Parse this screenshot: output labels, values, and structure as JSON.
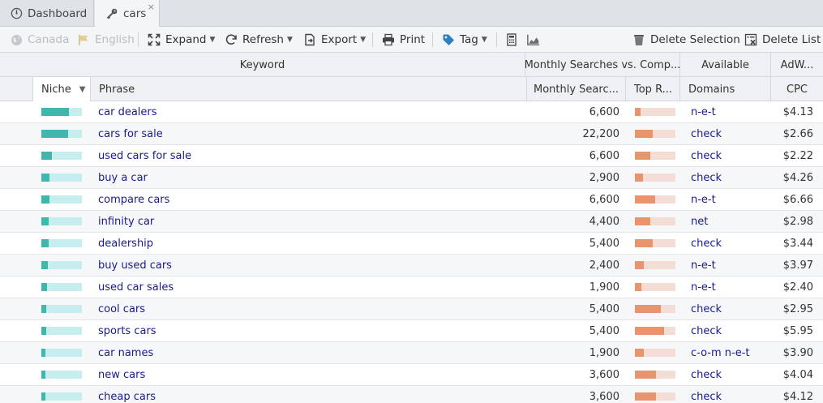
{
  "tabs": [
    {
      "label": "Dashboard"
    },
    {
      "label": "cars",
      "close": "×"
    }
  ],
  "toolbar": {
    "canada": "Canada",
    "english": "English",
    "expand": "Expand",
    "refresh": "Refresh",
    "export": "Export",
    "print": "Print",
    "tag": "Tag",
    "delete_selection": "Delete Selection",
    "delete_list": "Delete List"
  },
  "header_groups": {
    "keyword": "Keyword",
    "monthly": "Monthly Searches vs. Comp...",
    "available": "Available",
    "adwords": "AdW..."
  },
  "columns": {
    "niche": "Niche",
    "phrase": "Phrase",
    "monthly_searches": "Monthly Searc...",
    "top_rank": "Top R...",
    "domains": "Domains",
    "cpc": "CPC"
  },
  "rows": [
    {
      "niche": 0.68,
      "phrase": "car dealers",
      "searches": "6,600",
      "top": 0.14,
      "domains": "n-e-t",
      "cpc": "$4.13"
    },
    {
      "niche": 0.66,
      "phrase": "cars for sale",
      "searches": "22,200",
      "top": 0.44,
      "domains": "check",
      "cpc": "$2.66"
    },
    {
      "niche": 0.26,
      "phrase": "used cars for sale",
      "searches": "6,600",
      "top": 0.38,
      "domains": "check",
      "cpc": "$2.22"
    },
    {
      "niche": 0.2,
      "phrase": "buy a car",
      "searches": "2,900",
      "top": 0.2,
      "domains": "check",
      "cpc": "$4.26"
    },
    {
      "niche": 0.2,
      "phrase": "compare cars",
      "searches": "6,600",
      "top": 0.5,
      "domains": "n-e-t",
      "cpc": "$6.66"
    },
    {
      "niche": 0.18,
      "phrase": "infinity car",
      "searches": "4,400",
      "top": 0.38,
      "domains": "net",
      "cpc": "$2.98"
    },
    {
      "niche": 0.18,
      "phrase": "dealership",
      "searches": "5,400",
      "top": 0.44,
      "domains": "check",
      "cpc": "$3.44"
    },
    {
      "niche": 0.16,
      "phrase": "buy used cars",
      "searches": "2,400",
      "top": 0.22,
      "domains": "n-e-t",
      "cpc": "$3.97"
    },
    {
      "niche": 0.14,
      "phrase": "used car sales",
      "searches": "1,900",
      "top": 0.16,
      "domains": "n-e-t",
      "cpc": "$2.40"
    },
    {
      "niche": 0.12,
      "phrase": "cool cars",
      "searches": "5,400",
      "top": 0.64,
      "domains": "check",
      "cpc": "$2.95"
    },
    {
      "niche": 0.12,
      "phrase": "sports cars",
      "searches": "5,400",
      "top": 0.72,
      "domains": "check",
      "cpc": "$5.95"
    },
    {
      "niche": 0.1,
      "phrase": "car names",
      "searches": "1,900",
      "top": 0.22,
      "domains": "c-o-m n-e-t",
      "cpc": "$3.90"
    },
    {
      "niche": 0.1,
      "phrase": "new cars",
      "searches": "3,600",
      "top": 0.52,
      "domains": "check",
      "cpc": "$4.04"
    },
    {
      "niche": 0.1,
      "phrase": "cheap cars",
      "searches": "3,600",
      "top": 0.52,
      "domains": "check",
      "cpc": "$4.12"
    }
  ]
}
